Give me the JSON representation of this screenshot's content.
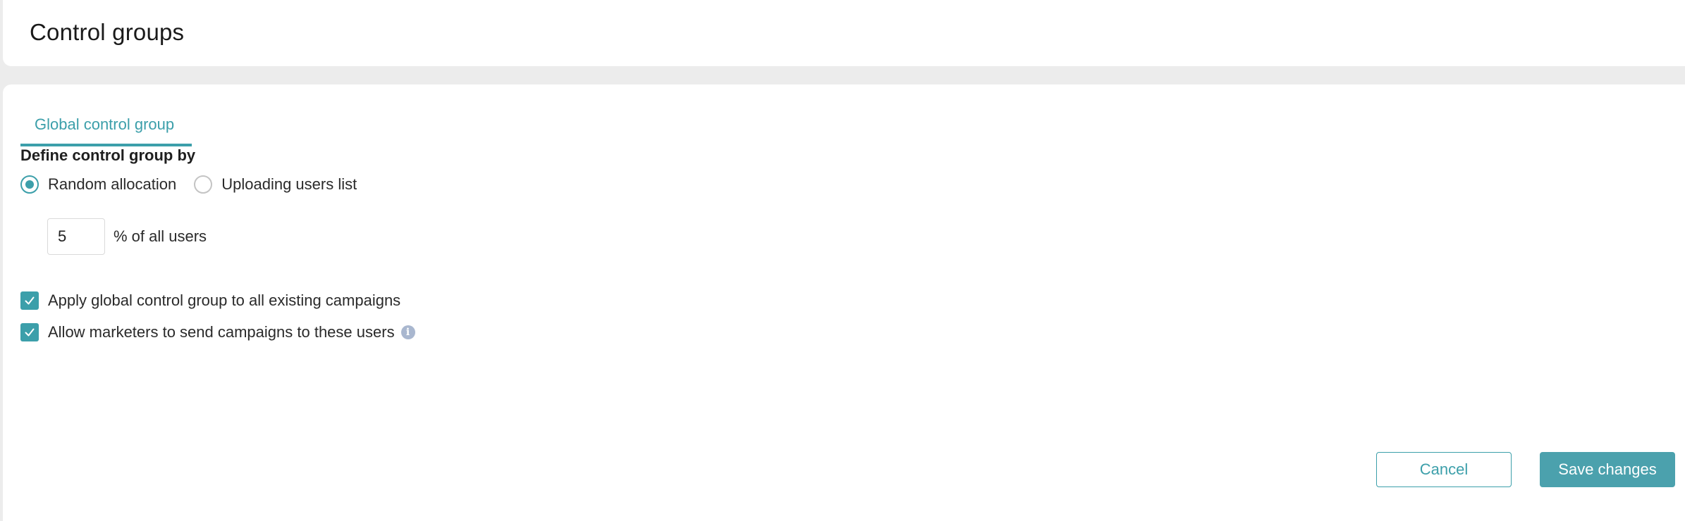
{
  "header": {
    "title": "Control groups"
  },
  "tabs": [
    {
      "label": "Global control group",
      "active": true
    }
  ],
  "form": {
    "section_label": "Define control group by",
    "radio_options": [
      {
        "label": "Random allocation",
        "checked": true
      },
      {
        "label": "Uploading users list",
        "checked": false
      }
    ],
    "percent_value": "5",
    "percent_label": "% of all users",
    "checkboxes": [
      {
        "label": "Apply global control group to all existing campaigns",
        "checked": true
      },
      {
        "label": "Allow marketers to send campaigns to these users",
        "checked": true,
        "info_icon": "info-icon"
      }
    ]
  },
  "actions": {
    "cancel_label": "Cancel",
    "save_label": "Save changes"
  },
  "colors": {
    "accent": "#3c9faa",
    "save_button": "#4ba1ad",
    "info_icon": "#a9b7cf",
    "background": "#ececec"
  }
}
